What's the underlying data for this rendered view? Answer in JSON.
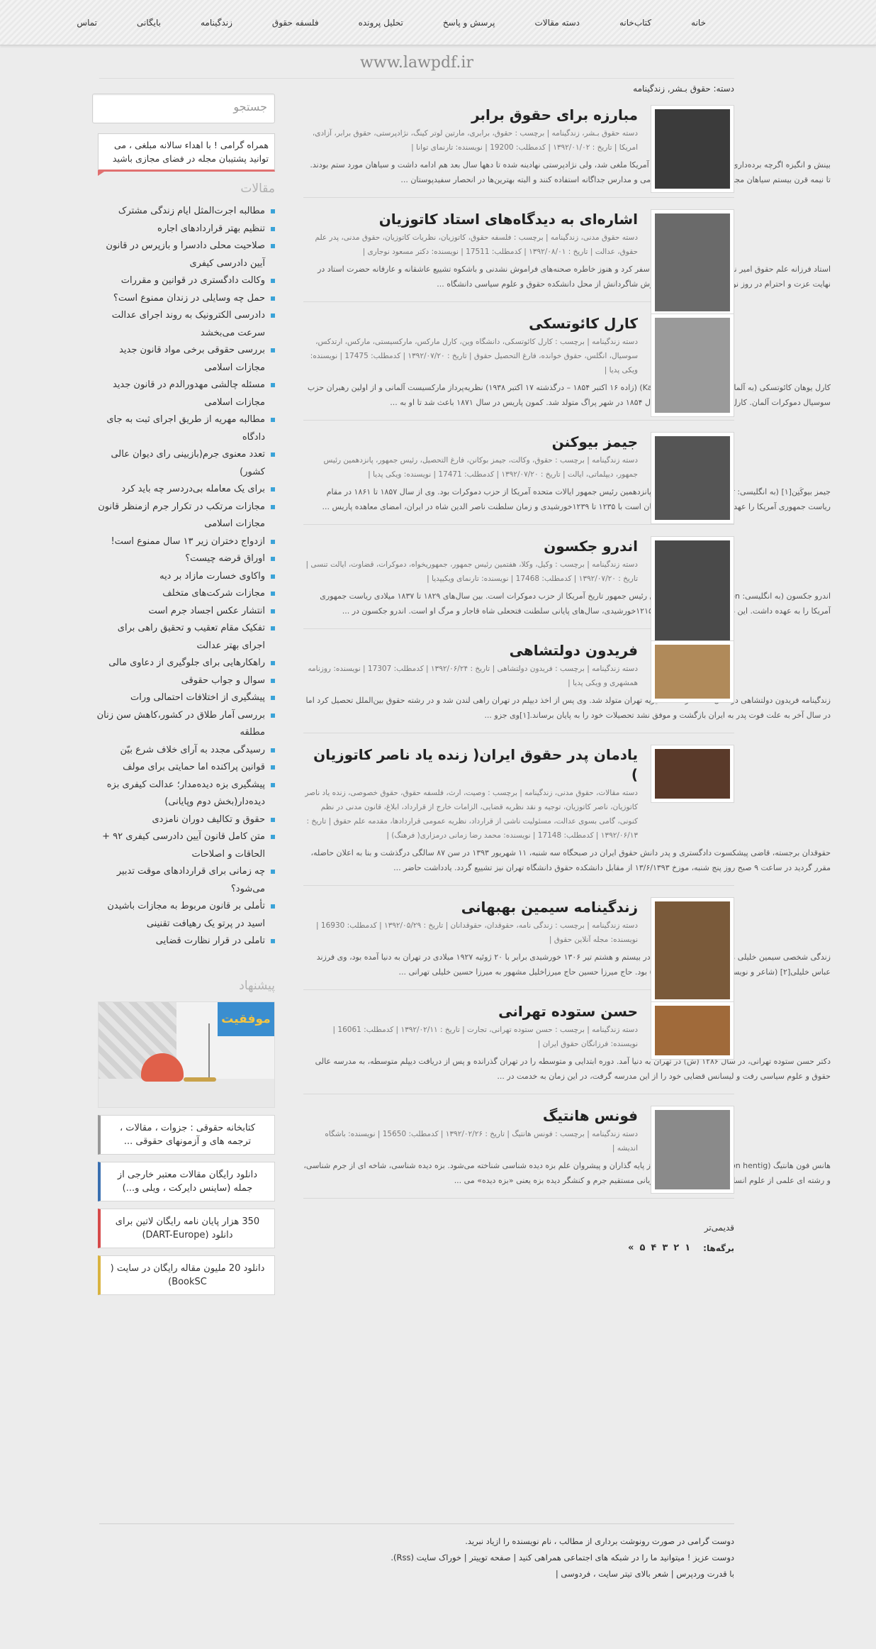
{
  "nav": [
    "خانه",
    "کتاب‌خانه",
    "دسته مقالات",
    "پرسش و پاسخ",
    "تحلیل پرونده",
    "فلسفه حقوق",
    "زندگینامه",
    "بایگانی",
    "تماس"
  ],
  "site_title": "www.lawpdf.ir",
  "category_crumb": "دسته: حقوق بـشر, زندگینامه",
  "posts": [
    {
      "title": "مبارزه برای حقوق برابر",
      "meta": "دسته حقوق بـشر، زندگینامه | برچسب : حقوق، برابری، مارتین لوتر کینگ، نژادپرستی، حقوق برابر، آزادی، امریکا | تاریخ : ۱۳۹۲/۰۱/۰۲ | کدمطلب: 19200 | نویسنده: تارنمای توانا |",
      "excerpt": "بینش و انگیزه اگرچه برده‌داری در اواخر قرن نوزدهم در آمریکا ملغی شد، ولی نژادپرستی نهادینه شده تا دهها سال بعد هم ادامه داشت و سیاهان مورد ستم بودند. تا نیمه قرن بیستم سیاهان مجبور بودند از مکان‌های عمومی و مدارس جداگانه استفاده کنند و البته بهترین‌ها در انحصار سفیدپوستان ..."
    },
    {
      "title": "اشاره‌ای به دیدگاه‌های استاد کاتوزیان",
      "meta": "دسته حقوق مدنی، زندگینامه | برچسب : فلسفه حقوق، کاتوزیان، نظریات کاتوزیان، حقوق مدنی، پدر علم حقوق، عدالت | تاریخ : ۱۳۹۲/۰۸/۰۱ | کدمطلب: 17511 | نویسنده: دکتر مسعود نوجاری |",
      "excerpt": "استاد فرزانه علم حقوق امیر ناصر کاتوزیان به دیار باقی سفر کرد و هنوز خاطره صحنه‌های فراموش نشدنی و باشکوه تشییع عاشقانه و عارفانه حضرت استاد در نهایت عزت و احترام در روز نوزدهم ماه سال جاری پردوش شاگردانش از محل دانشکده حقوق و علوم سیاسی دانشگاه ..."
    },
    {
      "title": "کارل کائوتسکی",
      "meta": "دسته زندگینامه | برچسب : کارل کائوتسکی، دانشگاه وین، کارل مارکس، مارکسیستی، مارکس، ارتدکس، سوسیال، انگلس، حقوق خوانده، فارغ التحصیل حقوق | تاریخ : ۱۳۹۲/۰۷/۲۰ | کدمطلب: 17475 | نویسنده: ویکی پدیا |",
      "excerpt": "کارل یوهان کائوتسکی (به آلمانی: Karl Johann Kautsky) (زاده ۱۶ اکتبر ۱۸۵۴ – درگذشته ۱۷ اکتبر ۱۹۳۸) نظریه‌پرداز مارکسیست آلمانی و از اولین رهبران حزب سوسیال دموکرات آلمان. کارل کائوتسکی کائوتسکی سال ۱۸۵۴ در شهر پراگ متولد شد. کمون پاریس در سال ۱۸۷۱ باعث شد تا او به ..."
    },
    {
      "title": "جیمز بیوکنن",
      "meta": "دسته زندگینامه | برچسب : حقوق، وکالت، جیمز بوکانن، فارغ التحصیل، رئیس جمهور، پانزدهمین رئیس جمهور، دیپلماتی، ایالت | تاریخ : ۱۳۹۲/۰۷/۲۰ | کدمطلب: 17471 | نویسنده: ویکی پدیا |",
      "excerpt": "جیمز بیوکَنِن[۱] (به انگلیسی: James Buchanan, Jr.) پانزدهمین رئیس جمهور ایالات متحده آمریکا از حزب دموکرات بود. وی از سال ۱۸۵۷ تا ۱۸۶۱ در مقام ریاست جمهوری آمریکا را عهده‌دار بود. این دوران همزمان است با ۱۲۳۵ تا ۱۲۳۹خورشیدی و زمان سلطنت ناصر الدین شاه در ایران، امضای معاهده پاریس ..."
    },
    {
      "title": "اندرو جکسون",
      "meta": "دسته زندگینامه | برچسب : وکیل، وکلا، هفتمین رئیس جمهور، جمهوریخواه، دموکرات، قضاوت، ایالت تنسی | تاریخ : ۱۳۹۲/۰۷/۲۰ | کدمطلب: 17468 | نویسنده: تارنمای ویکیپدیا |",
      "excerpt": "اندرو جکسون (به انگلیسی: Andrew Jackson) هفتمین رئیس جمهور تاریخ آمریکا از حزب دموکرات است. بین سال‌های ۱۸۲۹ تا ۱۸۳۷ میلادی ریاست جمهوری آمریکا را به عهده داشت. این دوران همزمان با ۱۲۰۷ تا ۱۲۱۵خورشیدی، سال‌های پایانی سلطنت فتحعلی شاه قاجار و مرگ او است. اندرو جکسون در ..."
    },
    {
      "title": "فریدون دولتشاهی",
      "meta": "دسته زندگینامه | برچسب : فریدون دولتشاهی | تاریخ : ۱۳۹۲/۰۶/۲۴ | کدمطلب: 17307 | نویسنده: روزنامه همشهری و ویکی پدیا |",
      "excerpt": "زندگینامه فریدون دولتشاهی در سال ۱۳۱۷ در محله منیریه تهران متولد شد. وی پس از اخذ دیپلم در تهران راهی لندن شد و در رشته حقوق بین‌الملل تحصیل کرد اما در سال آخر به علت فوت پدر به ایران بازگشت و موفق نشد تحصیلات خود را به پایان برساند.[۱]وی جزو ..."
    },
    {
      "title": "یادمان پدر حقوق ایران( زنده یاد ناصر کاتوزیان )",
      "meta": "دسته مقالات، حقوق مدنی، زندگینامه | برچسب : وصیت، ارث، فلسفه حقوق، حقوق خصوصی، زنده یاد ناصر کاتوزیان، ناصر کاتوزیان، توجیه و نقد نظریه قضایی، الزامات خارج از قرارداد، ابلاغ، قانون مدنی در نظم کنونی، گامی بسوی عدالت، مسئولیت ناشی از قرارداد، نظریه عمومی قراردادها، مقدمه علم حقوق | تاریخ : ۱۳۹۲/۰۶/۱۳ | کدمطلب: 17148 | نویسنده: محمد رضا زمانی درمزاری( فرهنگ) |",
      "excerpt": "حقوقدان برجسته، قاضی پیشکسوت دادگستری و پدر دانش حقوق ایران در صبحگاه سه شنبه، ۱۱ شهریور ۱۳۹۳ در سن ۸۷ سالگی درگذشت و بنا به اعلان حاضله، مقرر گردید در ساعت ۹ صبح روز پنج شنبه، موزخ ۱۳/۶/۱۳۹۳ از مقابل دانشکده حقوق دانشگاه تهران نیز تشییع گردد. یادداشت حاضر ..."
    },
    {
      "title": "زندگینامه سیمین بهبهانی",
      "meta": "دسته زندگینامه | برچسب : زندگی نامه، حقوقدان، حقوقدانان | تاریخ : ۱۳۹۲/۰۵/۲۹ | کدمطلب: 16930 | نویسنده: مجله آنلاین حقوق |",
      "excerpt": "زندگی شخصی سیمین خلیلی معروف به سیمین بهبهانی در بیستم و هشتم تیر ۱۳۰۶ خورشیدی برابر با ۲۰ ژوئیه ۱۹۲۷ میلادی در تهران به دنیا آمده بود، وی فرزند عباس خلیلی[۲] (شاعر و نویسنده و مدیر روزنامه اقدام) بود. حاج میرزا حسین حاج میرزاخلیل مشهور به میرزا حسین خلیلی تهرانی ..."
    },
    {
      "title": "حسن ستوده تهرانی",
      "meta": "دسته زندگینامه | برچسب : حسن ستوده تهرانی، تجارت | تاریخ : ۱۳۹۲/۰۲/۱۱ | کدمطلب: 16061 | نویسنده: فرزانگان حقوق ایران |",
      "excerpt": "دکتر حسن ستوده تهرانی، در سال ۱۲۸۶ (ش) در تهران به دنیا آمد. دوره ابتدایی و متوسطه را در تهران گذرانده و پس از دریافت دیپلم متوسطه، به مدرسه عالی حقوق و علوم سیاسی رفت و لیسانس قضایی خود را از این مدرسه گرفت، در این زمان به خدمت در ..."
    },
    {
      "title": "فونس هانتیگ",
      "meta": "دسته زندگینامه | برچسب : فونس هانتیگ | تاریخ : ۱۳۹۲/۰۲/۲۶ | کدمطلب: 15650 | نویسنده: باشگاه اندیشه |",
      "excerpt": "هانس فون هانتیگ (Hans von hentig) به عنوان یکی از پایه گذاران و پیشروان علم بزه دیده شناسی شناخته می‌شود. بزه دیده شناسی، شاخه ای از جرم شناسی، و رشته ای علمی از علوم انسانی است که به مطالعه قربانی مستقیم جرم و کنشگر دیده بزه یعنی «بزه دیده» می ..."
    }
  ],
  "older_link": "قدیمی‌تر",
  "pager": {
    "label": "برگه‌ها:",
    "pages": [
      "۱",
      "۲",
      "۳",
      "۴",
      "۵"
    ],
    "next": "»"
  },
  "footer": [
    "دوست گرامی در صورت رونوشت برداری از مطالب ، نام نویسنده را ازیاد نبرید.",
    "دوست عزیز ! میتوانید ما را در شبکه های اجتماعی همراهی کنید | صفحه توییتر | خوراک سایت (Rss).",
    "با قدرت وردپرس | شعر بالای تیتر سایت ، فردوسی |"
  ],
  "sidebar": {
    "search_placeholder": "جستجو",
    "notice": "همراه گرامی ! با اهداء سالانه مبلغی ، می توانید پشتیبان مجله در فضای مجازی باشید",
    "articles_title": "مقالات",
    "articles": [
      "مطالبه اجرت‌المثل ایام زندگی مشترک",
      "تنظیم بهتر قراردادهای اجاره",
      "صلاحیت محلی دادسرا و بازپرس در قانون آیین دادرسی کیفری",
      "وکالت دادگستری در قوانین و مقررات",
      "حمل چه وسایلی در زندان ممنوع است؟",
      "دادرسی الکترونیک به روند اجرای عدالت سرعت می‌بخشد",
      "بررسی حقوقی برخی مواد قانون جدید مجازات اسلامی",
      "مسئله چالشی مهدورالدم در قانون جدید مجازات اسلامی",
      "مطالبه مهریه از طریق اجرای ثبت به جای دادگاه",
      "تعدد معنوی جرم(بازبینی رای دیوان عالی کشور)",
      "برای یک معامله بی‌دردسر چه باید کرد",
      "مجازات مرتکب در تکرار جرم ازمنظر قانون مجازات اسلامی",
      "ازدواج دختران زیر ۱۳ سال ممنوع است!",
      "اوراق قرضه چیست؟",
      "واکاوی خسارت مازاد بر دیه",
      "مجازات شرکت‌های متخلف",
      "انتشار عکس اجساد جرم است",
      "تفکیک مقام تعقیب و تحقیق راهی برای اجرای بهتر عدالت",
      "راهکارهایی برای جلوگیری از دعاوی مالی",
      "سوال و جواب حقوقی",
      "پیشگیری از اختلافات احتمالی ورات",
      "بررسی آمار طلاق در کشور،کاهش سن زنان مطلقه",
      "رسیدگی مجدد به آرای خلاف شرع بیّن",
      "قوانین پراکنده اما حمایتی برای مولف",
      "پیشگیری بزه دیده‌مدار؛ عدالت کیفری بزه دیده‌دار(بخش دوم وپایانی)",
      "حقوق و تکالیف دوران نامزدی",
      "متن کامل قانون آیین دادرسی کیفری ۹۲ + الحاقات و اصلاحات",
      "چه زمانی برای قراردادهای موقت تدبیر می‌شود؟",
      "تأملی بر قانون مربوط به مجازات باشیدن اسید در پرتو یک رهیافت تقنینی",
      "تاملی در قرار نظارت قضایی"
    ],
    "suggest_title": "پیشنهاد",
    "ad_text": "موفقیت",
    "links": [
      "کتابخانه حقوقی : جزوات ، مقالات ، ترجمه های و آزمونهای حقوقی ...",
      "دانلود رایگان مقالات معتبر خارجی از جمله (ساینس دایرکت ، ویلی و...)",
      "350 هزار پایان نامه رایگان لاتین برای دانلود (DART-Europe)",
      "دانلود 20 ملیون مقاله رایگان در سایت ( BookSC)"
    ]
  },
  "colors": {
    "accent": "#3aa3d8",
    "notice_border": "#e07070",
    "background": "#ececec"
  }
}
